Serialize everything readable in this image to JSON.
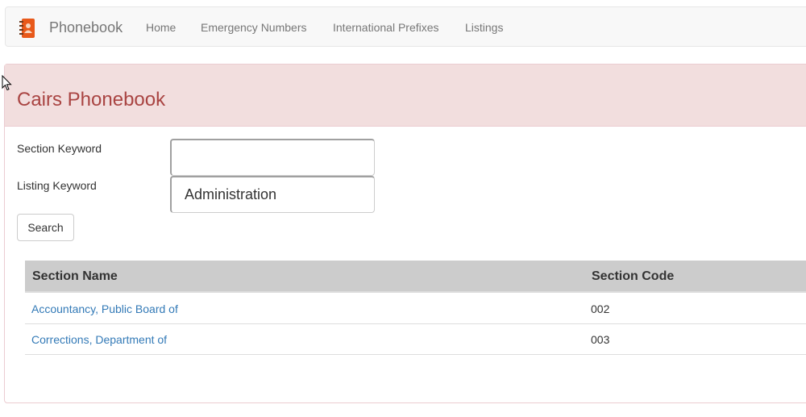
{
  "navbar": {
    "brand": "Phonebook",
    "brand_icon": "address-book-icon",
    "items": [
      {
        "label": "Home"
      },
      {
        "label": "Emergency Numbers"
      },
      {
        "label": "International Prefixes"
      },
      {
        "label": "Listings"
      }
    ]
  },
  "panel": {
    "title": "Cairs Phonebook"
  },
  "form": {
    "section_label": "Section Keyword",
    "section_value": "",
    "listing_label": "Listing Keyword",
    "listing_value": "Administration",
    "search_label": "Search"
  },
  "table": {
    "headers": [
      "Section Name",
      "Section Code"
    ],
    "rows": [
      {
        "name": "Accountancy, Public Board of",
        "code": "002"
      },
      {
        "name": "Corrections, Department of",
        "code": "003"
      }
    ]
  },
  "colors": {
    "heading_bg": "#f2dede",
    "heading_text": "#a94442",
    "link": "#337ab7",
    "table_header_bg": "#cccccc",
    "brand_icon": "#e8591a"
  }
}
